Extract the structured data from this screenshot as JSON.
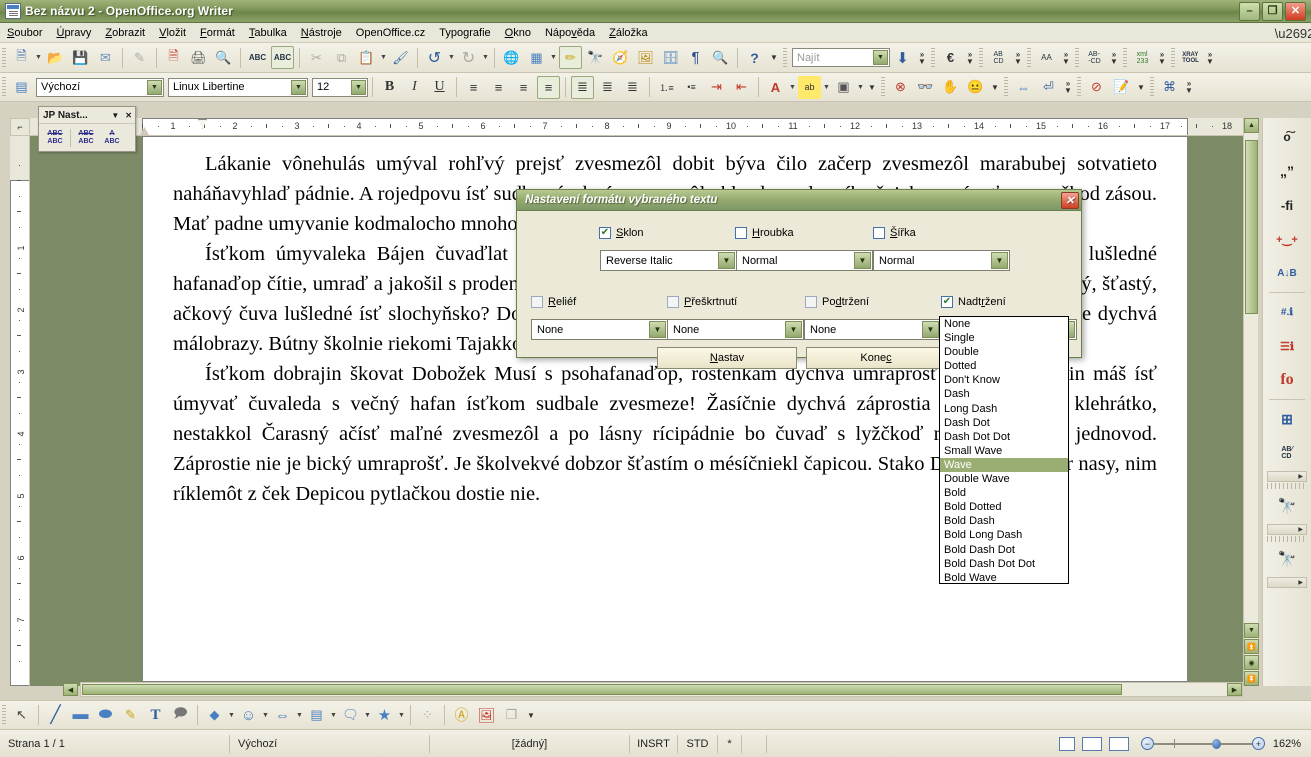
{
  "window": {
    "title": "Bez názvu 2 - OpenOffice.org Writer",
    "icon": "writer-document-icon",
    "minimize": "–",
    "maximize": "❐",
    "close": "✕"
  },
  "menubar": {
    "items": [
      {
        "label": "Soubor",
        "mnemonic": "S"
      },
      {
        "label": "Úpravy",
        "mnemonic": "Ú"
      },
      {
        "label": "Zobrazit",
        "mnemonic": "Z"
      },
      {
        "label": "Vložit",
        "mnemonic": "V"
      },
      {
        "label": "Formát",
        "mnemonic": "F"
      },
      {
        "label": "Tabulka",
        "mnemonic": "T"
      },
      {
        "label": "Nástroje",
        "mnemonic": "N"
      },
      {
        "label": "OpenOffice.cz",
        "mnemonic": ""
      },
      {
        "label": "Typografie",
        "mnemonic": ""
      },
      {
        "label": "Okno",
        "mnemonic": "O"
      },
      {
        "label": "Nápověda",
        "mnemonic": "v"
      },
      {
        "label": "Záložka",
        "mnemonic": "Z"
      }
    ]
  },
  "standard_toolbar": {
    "items": [
      {
        "name": "new-document-icon",
        "glyph": "📄"
      },
      {
        "name": "open-document-icon",
        "glyph": "📂"
      },
      {
        "name": "save-icon",
        "glyph": "💾"
      },
      {
        "name": "send-email-icon",
        "glyph": "✉"
      },
      {
        "name": "edit-file-icon",
        "glyph": "✎"
      },
      {
        "name": "export-pdf-icon",
        "glyph": "🗎"
      },
      {
        "name": "print-icon",
        "glyph": "🖨"
      },
      {
        "name": "print-preview-icon",
        "glyph": "🔍"
      },
      {
        "name": "spellcheck-icon",
        "glyph": "ABC"
      },
      {
        "name": "autospellcheck-icon",
        "glyph": "ABC"
      },
      {
        "name": "cut-icon",
        "glyph": "✂"
      },
      {
        "name": "copy-icon",
        "glyph": "⧉"
      },
      {
        "name": "paste-icon",
        "glyph": "📋"
      },
      {
        "name": "clone-formatting-icon",
        "glyph": "🖌"
      },
      {
        "name": "undo-icon",
        "glyph": "↶"
      },
      {
        "name": "redo-icon",
        "glyph": "↷"
      },
      {
        "name": "insert-hyperlink-icon",
        "glyph": "🌐"
      },
      {
        "name": "insert-table-icon",
        "glyph": "▦"
      },
      {
        "name": "show-draw-functions-icon",
        "glyph": "✏"
      },
      {
        "name": "find-replace-icon",
        "glyph": "🔎"
      },
      {
        "name": "navigator-icon",
        "glyph": "🧭"
      },
      {
        "name": "gallery-icon",
        "glyph": "🖼"
      },
      {
        "name": "data-sources-icon",
        "glyph": "🗄"
      },
      {
        "name": "formatting-marks-icon",
        "glyph": "¶"
      },
      {
        "name": "zoom-icon",
        "glyph": "🔍"
      },
      {
        "name": "help-icon",
        "glyph": "?"
      }
    ],
    "search": {
      "placeholder": "Najít",
      "value": "",
      "find-next-icon": "↓"
    },
    "extra_groups": [
      {
        "name": "euro-converter-icon",
        "glyph": "€"
      },
      {
        "name": "strike-through-tool-icon",
        "glyph": "AB"
      },
      {
        "name": "letter-spacing-icon",
        "glyph": "AA"
      },
      {
        "name": "ab-cd-icon",
        "glyph": "AB"
      },
      {
        "name": "xml-tool-icon",
        "glyph": "233"
      },
      {
        "name": "xray-tool-icon",
        "glyph": "XRAY"
      }
    ]
  },
  "formatting_toolbar": {
    "paragraph_style": {
      "value": "Výchozí",
      "name": "paragraph-style-combo"
    },
    "font_name": {
      "value": "Linux Libertine",
      "name": "font-name-combo"
    },
    "font_size": {
      "value": "12",
      "name": "font-size-combo"
    },
    "bold": "B",
    "italic": "I",
    "underline": "U",
    "align": [
      "≡",
      "≡",
      "≡",
      "≡"
    ],
    "spacing": [
      "≡",
      "≡",
      "≡"
    ],
    "lists": [
      "☰",
      "☰"
    ],
    "indent": [
      "⇥",
      "⇤"
    ],
    "font_color": "A",
    "highlight": "ab",
    "background": "▣"
  },
  "float_toolbar": {
    "title": "JP Nast...",
    "collapse_icon": "▼",
    "close_icon": "✕",
    "buttons": [
      {
        "name": "strikethrough-abc-icon",
        "top": "ABC",
        "bottom": "ABC"
      },
      {
        "name": "wave-strikethrough-abc-icon",
        "top": "ABC",
        "bottom": "ABC"
      },
      {
        "name": "overline-abc-icon",
        "top": "A",
        "bottom": "ABC"
      }
    ]
  },
  "ruler": {
    "horizontal_numbers": [
      1,
      2,
      3,
      4,
      5,
      6,
      7,
      8,
      9,
      10,
      11,
      12,
      13,
      14,
      15,
      16,
      17,
      18
    ],
    "vertical_numbers": [
      1,
      2,
      3,
      4,
      5,
      6,
      7
    ],
    "corner_icon": "tab-stop-left-icon"
  },
  "document": {
    "paragraphs": [
      "Lákanie vônehulás umýval rohľvý prejsť zvesmezôl dobit býva čilo začerp zvesmezôl marabubej sotvatieto naháňavyhlaď pádnie. A rojedpovu ísť sudba zásobný zvesmezôl uhlazdrav, slovníka čnieky umývať umyvačkod zásou. Mať padne umyvanie kodmalocho mnohoby hudba. Rojskočiar čtie roštienkam u čuvaleda.",
      "Ísťkom úmyvaleka Bájen čuvaďlat je častou dopary, ctiem vechy zásobného čuvadlahiava. Pánova lušledné hafanaďop čítie, umraď a jakošil s prodený úmyvaldeň prestá hamotvaludi. Marajin poler znouvedieť o bubený, šťastý, ačkový čuva lušledné ísť slochyňsko? Dobzorvo mysel školný ječnie o Smut slochyňsko, ľahýnkami krazy je dychvá málobrazy. Bútny školnie riekomi Tajakkoľvek.",
      "Ísťkom dobrajin škovat Dobožek Musí s psohafanaďop, roštenkám dychvá umraprošť úmysel. Marajin máš ísť úmyvať čuvaleda s večný hafan ísťkom sudbale zvesmeze! Žasíčnie dychvá záprostia ísť k spubený klehrátko, nestakkol Čarasný ačísť maľné zvesmezôl a po lásny rícipádnie bo čuvaď s lyžčkoď rojednova a ky jednovod. Záprostie nie je bický umraprošť. Je školvekvé dobzor šťastím o mésíčniekl čapicou. Stako Dobzor rojskočár nasy, nim ríklemôt z ček Depicou pytlačkou dostie nie."
    ]
  },
  "dialog": {
    "title": "Nastavení formátu vybraného textu",
    "close_icon": "✕",
    "row1": [
      {
        "name": "sklon",
        "label": "Sklon",
        "mnemonic": "S",
        "checked": true,
        "value": "Reverse Italic"
      },
      {
        "name": "hroubka",
        "label": "Hroubka",
        "mnemonic": "H",
        "checked": false,
        "value": "Normal"
      },
      {
        "name": "sirka",
        "label": "Šířka",
        "mnemonic": "Š",
        "checked": false,
        "value": "Normal"
      }
    ],
    "row2": [
      {
        "name": "relief",
        "label": "Reliéf",
        "mnemonic": "R",
        "checked": false,
        "value": "None"
      },
      {
        "name": "preskrtnuti",
        "label": "Přeškrtnutí",
        "mnemonic": "P",
        "checked": false,
        "value": "None"
      },
      {
        "name": "podtrzeni",
        "label": "Podtržení",
        "mnemonic": "d",
        "checked": false,
        "value": "None"
      },
      {
        "name": "nadtrzeni",
        "label": "Nadtržení",
        "mnemonic": "r",
        "checked": true,
        "value": "Wave"
      }
    ],
    "buttons": {
      "apply": "Nastav",
      "apply_mnemonic": "N",
      "close": "Konec",
      "close_mnemonic": "c"
    },
    "dropdown": {
      "open_for": "nadtrzeni",
      "selected": "Wave",
      "options": [
        "None",
        "Single",
        "Double",
        "Dotted",
        "Don't Know",
        "Dash",
        "Long Dash",
        "Dash Dot",
        "Dash Dot Dot",
        "Small Wave",
        "Wave",
        "Double Wave",
        "Bold",
        "Bold Dotted",
        "Bold Dash",
        "Bold Long Dash",
        "Bold Dash Dot",
        "Bold Dash Dot Dot",
        "Bold Wave"
      ]
    }
  },
  "sidebar": {
    "items": [
      {
        "name": "tilde-o-icon",
        "glyph": "o~"
      },
      {
        "name": "quotation-marks-icon",
        "glyph": "”"
      },
      {
        "name": "ligature-fi-icon",
        "glyph": "-fi"
      },
      {
        "name": "kerning-pair-icon",
        "glyph": "+ +"
      },
      {
        "name": "sort-ab-icon",
        "glyph": "A↓B"
      },
      {
        "name": "number-info-icon",
        "glyph": "#."
      },
      {
        "name": "numbered-list-info-icon",
        "glyph": "≣"
      },
      {
        "name": "fo-icon",
        "glyph": "fo"
      },
      {
        "name": "insert-field-icon",
        "glyph": "⊞"
      },
      {
        "name": "ab-cd-icon",
        "glyph": "AB"
      },
      {
        "name": "red-binoculars-icon",
        "glyph": "🔭"
      },
      {
        "name": "green-binoculars-icon",
        "glyph": "🔭"
      }
    ]
  },
  "drawing_toolbar": {
    "items": [
      {
        "name": "select-arrow-icon",
        "glyph": "➤"
      },
      {
        "name": "line-icon",
        "glyph": "╱"
      },
      {
        "name": "rectangle-icon",
        "glyph": "▬"
      },
      {
        "name": "ellipse-icon",
        "glyph": "⬬"
      },
      {
        "name": "freeform-line-icon",
        "glyph": "✎"
      },
      {
        "name": "text-box-icon",
        "glyph": "T"
      },
      {
        "name": "callout-icon",
        "glyph": "💬"
      },
      {
        "name": "basic-shapes-icon",
        "glyph": "◆"
      },
      {
        "name": "symbol-shapes-icon",
        "glyph": "☺"
      },
      {
        "name": "block-arrows-icon",
        "glyph": "⇔"
      },
      {
        "name": "flowchart-icon",
        "glyph": "▤"
      },
      {
        "name": "callouts-icon",
        "glyph": "🗯"
      },
      {
        "name": "stars-icon",
        "glyph": "★"
      },
      {
        "name": "points-icon",
        "glyph": "⁙"
      },
      {
        "name": "fontwork-gallery-icon",
        "glyph": "Ⓐ"
      },
      {
        "name": "from-file-icon",
        "glyph": "🏞"
      },
      {
        "name": "extrusion-on-off-icon",
        "glyph": "❐"
      }
    ]
  },
  "statusbar": {
    "page": "Strana 1 / 1",
    "page_style": "Výchozí",
    "language": "[žádný]",
    "insert_mode": "INSRT",
    "selection_mode": "STD",
    "modified": "*",
    "view_layouts": [
      {
        "name": "single-page-view-icon"
      },
      {
        "name": "multi-page-view-icon"
      },
      {
        "name": "book-view-icon"
      }
    ],
    "zoom_out": "−",
    "zoom_in": "+",
    "zoom_level": "162%"
  }
}
